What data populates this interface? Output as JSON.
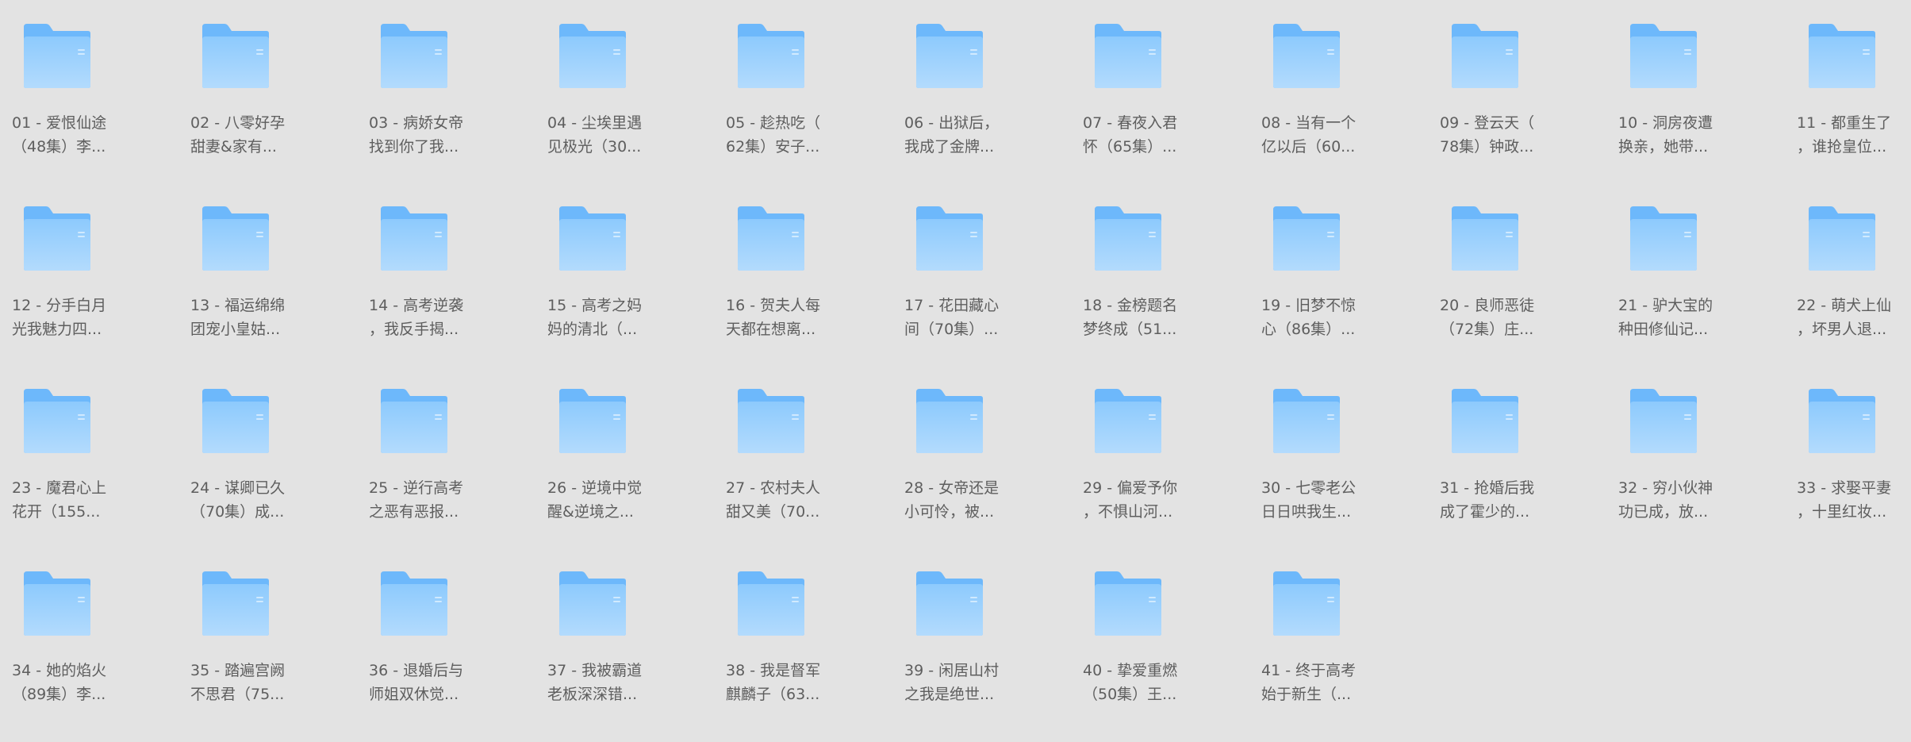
{
  "icon": "folder-icon",
  "colors": {
    "background": "#e3e3e3",
    "folder_back": "#6db8fb",
    "folder_front_top": "#8dcafd",
    "folder_front_bottom": "#b3dbfd",
    "label_text": "#5e5e5e"
  },
  "folders": [
    {
      "line1": "01 - 爱恨仙途",
      "line2": "（48集）李..."
    },
    {
      "line1": "02 - 八零好孕",
      "line2": "甜妻&家有..."
    },
    {
      "line1": "03 - 病娇女帝",
      "line2": "找到你了我..."
    },
    {
      "line1": "04 - 尘埃里遇",
      "line2": "见极光（30..."
    },
    {
      "line1": "05 - 趁热吃（",
      "line2": "62集）安子..."
    },
    {
      "line1": "06 - 出狱后，",
      "line2": "我成了金牌..."
    },
    {
      "line1": "07 - 春夜入君",
      "line2": "怀（65集）..."
    },
    {
      "line1": "08 - 当有一个",
      "line2": "亿以后（60..."
    },
    {
      "line1": "09 - 登云天（",
      "line2": "78集）钟政..."
    },
    {
      "line1": "10 - 洞房夜遭",
      "line2": "换亲，她带..."
    },
    {
      "line1": "11 - 都重生了",
      "line2": "，谁抢皇位..."
    },
    {
      "line1": "12 - 分手白月",
      "line2": "光我魅力四..."
    },
    {
      "line1": "13 - 福运绵绵",
      "line2": "团宠小皇姑..."
    },
    {
      "line1": "14 - 高考逆袭",
      "line2": "，我反手揭..."
    },
    {
      "line1": "15 - 高考之妈",
      "line2": "妈的清北（..."
    },
    {
      "line1": "16 - 贺夫人每",
      "line2": "天都在想离..."
    },
    {
      "line1": "17 - 花田藏心",
      "line2": "间（70集）..."
    },
    {
      "line1": "18 - 金榜题名",
      "line2": "梦终成（51..."
    },
    {
      "line1": "19 - 旧梦不惊",
      "line2": "心（86集）..."
    },
    {
      "line1": "20 - 良师恶徒",
      "line2": "（72集）庄..."
    },
    {
      "line1": "21 - 驴大宝的",
      "line2": "种田修仙记..."
    },
    {
      "line1": "22 - 萌犬上仙",
      "line2": "，坏男人退..."
    },
    {
      "line1": "23 - 魔君心上",
      "line2": "花开（155..."
    },
    {
      "line1": "24 - 谋卿已久",
      "line2": "（70集）成..."
    },
    {
      "line1": "25 - 逆行高考",
      "line2": "之恶有恶报..."
    },
    {
      "line1": "26 - 逆境中觉",
      "line2": "醒&逆境之..."
    },
    {
      "line1": "27 - 农村夫人",
      "line2": "甜又美（70..."
    },
    {
      "line1": "28 - 女帝还是",
      "line2": "小可怜，被..."
    },
    {
      "line1": "29 - 偏爱予你",
      "line2": "，不惧山河..."
    },
    {
      "line1": "30 - 七零老公",
      "line2": "日日哄我生..."
    },
    {
      "line1": "31 - 抢婚后我",
      "line2": "成了霍少的..."
    },
    {
      "line1": "32 - 穷小伙神",
      "line2": "功已成，放..."
    },
    {
      "line1": "33 - 求娶平妻",
      "line2": "，十里红妆..."
    },
    {
      "line1": "34 - 她的焰火",
      "line2": "（89集）李..."
    },
    {
      "line1": "35 - 踏遍宫阙",
      "line2": "不思君（75..."
    },
    {
      "line1": "36 - 退婚后与",
      "line2": "师姐双休觉..."
    },
    {
      "line1": "37 - 我被霸道",
      "line2": "老板深深错..."
    },
    {
      "line1": "38 - 我是督军",
      "line2": "麒麟子（63..."
    },
    {
      "line1": "39 - 闲居山村",
      "line2": "之我是绝世..."
    },
    {
      "line1": "40 - 挚爱重燃",
      "line2": "（50集）王..."
    },
    {
      "line1": "41 - 终于高考",
      "line2": "始于新生（..."
    }
  ]
}
